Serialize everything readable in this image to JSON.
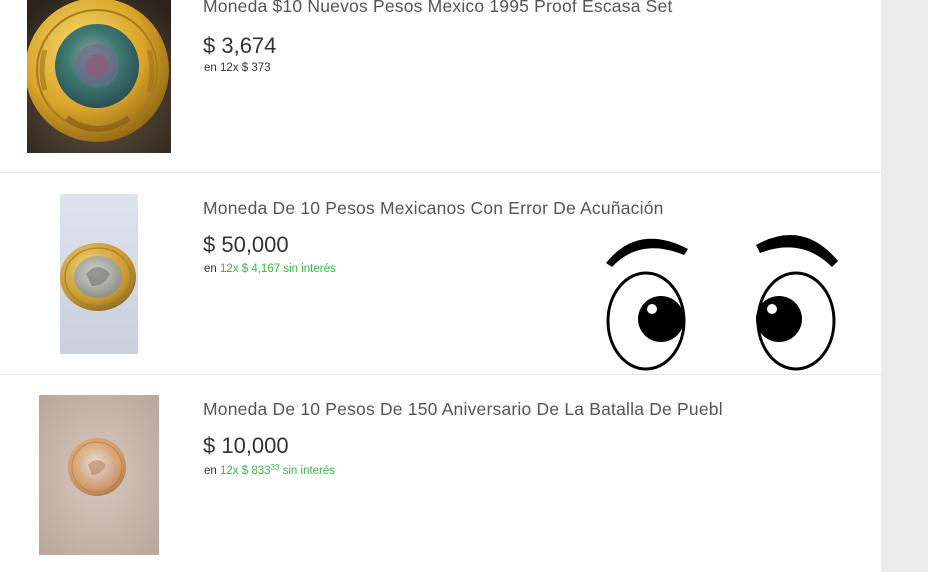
{
  "listings": [
    {
      "title": "Moneda $10 Nuevos Pesos Mexico 1995 Proof Escasa Set",
      "price": "$ 3,674",
      "installment_prefix": "en",
      "installment": "12x $ 373",
      "installment_cents": "",
      "installment_suffix": "",
      "installment_color": "#333333",
      "image_icon": "coin-photo-icon"
    },
    {
      "title": "Moneda De 10 Pesos Mexicanos Con Error De Acuñación",
      "price": "$ 50,000",
      "installment_prefix": "en",
      "installment": "12x $ 4,167",
      "installment_cents": "",
      "installment_suffix": "sin interés",
      "installment_color": "#39b54a",
      "image_icon": "coin-photo-icon"
    },
    {
      "title": "Moneda De 10 Pesos De 150 Aniversario De La Batalla De Puebl",
      "price": "$ 10,000",
      "installment_prefix": "en",
      "installment": "12x $ 833",
      "installment_cents": "33",
      "installment_suffix": "sin interés",
      "installment_color": "#39b54a",
      "image_icon": "coin-photo-icon"
    }
  ],
  "overlay": {
    "icon": "cartoon-eyes-icon"
  },
  "colors": {
    "accent_green": "#39b54a",
    "sidebar_gray": "#ececec",
    "divider": "#e6e6e6"
  }
}
